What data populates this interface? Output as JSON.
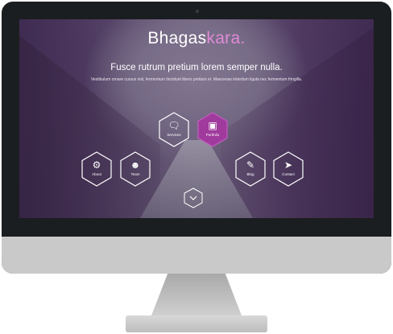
{
  "site": {
    "logo_part1": "Bhagas",
    "logo_part2": "kara",
    "logo_dot": ".",
    "tagline": "Fusce rutrum pretium lorem semper nulla.",
    "description": "Vestibulum ornare cursus nisl, fermentum tincidunt libero pretium et. Maecenas interdum ligula nec fermentum fringilla."
  },
  "nav": {
    "services": {
      "label": "Services",
      "icon": "chat-bubble-icon"
    },
    "portfolio": {
      "label": "Portfolio",
      "icon": "image-frame-icon"
    },
    "about": {
      "label": "About",
      "icon": "gear-icon"
    },
    "team": {
      "label": "Team",
      "icon": "person-icon"
    },
    "blog": {
      "label": "Blog",
      "icon": "pencil-icon"
    },
    "contact": {
      "label": "Contact",
      "icon": "paper-plane-icon"
    }
  },
  "colors": {
    "accent": "#a03a9c",
    "logo_accent": "#e08ad6"
  }
}
